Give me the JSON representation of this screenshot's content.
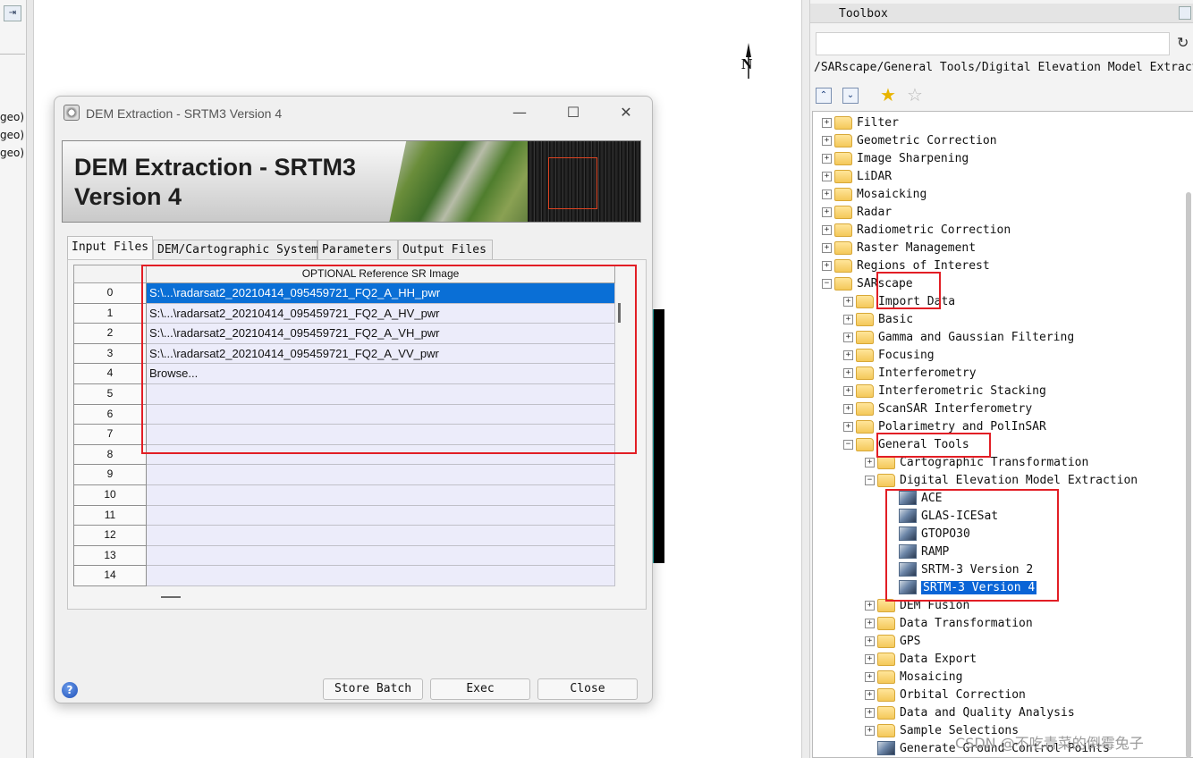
{
  "left_panel": {
    "pin_icon": "pin-icon",
    "lines": [
      "geo)",
      "geo)",
      "geo)"
    ]
  },
  "map": {
    "north_label": "N"
  },
  "dialog": {
    "title": "DEM Extraction - SRTM3 Version 4",
    "banner_line1": "DEM Extraction - SRTM3",
    "banner_line2": "Version 4",
    "controls": {
      "minimize": "—",
      "maximize": "☐",
      "close": "✕"
    },
    "tabs": [
      {
        "label": "Input Files",
        "active": true
      },
      {
        "label": "DEM/Cartographic System",
        "active": false
      },
      {
        "label": "Parameters",
        "active": false
      },
      {
        "label": "Output Files",
        "active": false
      }
    ],
    "grid": {
      "column_header": "OPTIONAL Reference SR Image",
      "rows": [
        {
          "index": "0",
          "value": "S:\\...\\radarsat2_20210414_095459721_FQ2_A_HH_pwr",
          "selected": true
        },
        {
          "index": "1",
          "value": "S:\\...\\radarsat2_20210414_095459721_FQ2_A_HV_pwr",
          "selected": false
        },
        {
          "index": "2",
          "value": "S:\\...\\radarsat2_20210414_095459721_FQ2_A_VH_pwr",
          "selected": false
        },
        {
          "index": "3",
          "value": "S:\\...\\radarsat2_20210414_095459721_FQ2_A_VV_pwr",
          "selected": false
        },
        {
          "index": "4",
          "value": "Browse...",
          "selected": false
        },
        {
          "index": "5",
          "value": "",
          "selected": false
        },
        {
          "index": "6",
          "value": "",
          "selected": false
        },
        {
          "index": "7",
          "value": "",
          "selected": false
        },
        {
          "index": "8",
          "value": "",
          "selected": false
        },
        {
          "index": "9",
          "value": "",
          "selected": false
        },
        {
          "index": "10",
          "value": "",
          "selected": false
        },
        {
          "index": "11",
          "value": "",
          "selected": false
        },
        {
          "index": "12",
          "value": "",
          "selected": false
        },
        {
          "index": "13",
          "value": "",
          "selected": false
        },
        {
          "index": "14",
          "value": "",
          "selected": false
        }
      ]
    },
    "buttons": {
      "store_batch": "Store Batch",
      "exec": "Exec",
      "close": "Close",
      "help": "?"
    }
  },
  "toolbox": {
    "title": "Toolbox",
    "search_value": "",
    "refresh_icon": "↻",
    "path": "/SARscape/General Tools/Digital Elevation Model Extraction",
    "bar": {
      "collapse": "⌃",
      "expand": "⌄",
      "fav_add": "★",
      "fav": "☆"
    },
    "tree": [
      {
        "label": "Filter",
        "level": 0,
        "type": "folder",
        "exp": "+"
      },
      {
        "label": "Geometric Correction",
        "level": 0,
        "type": "folder",
        "exp": "+"
      },
      {
        "label": "Image Sharpening",
        "level": 0,
        "type": "folder",
        "exp": "+"
      },
      {
        "label": "LiDAR",
        "level": 0,
        "type": "folder",
        "exp": "+"
      },
      {
        "label": "Mosaicking",
        "level": 0,
        "type": "folder",
        "exp": "+"
      },
      {
        "label": "Radar",
        "level": 0,
        "type": "folder",
        "exp": "+"
      },
      {
        "label": "Radiometric Correction",
        "level": 0,
        "type": "folder",
        "exp": "+"
      },
      {
        "label": "Raster Management",
        "level": 0,
        "type": "folder",
        "exp": "+"
      },
      {
        "label": "Regions of Interest",
        "level": 0,
        "type": "folder",
        "exp": "+"
      },
      {
        "label": "SARscape",
        "level": 0,
        "type": "folder",
        "exp": "−"
      },
      {
        "label": "Import Data",
        "level": 1,
        "type": "folder",
        "exp": "+"
      },
      {
        "label": "Basic",
        "level": 1,
        "type": "folder",
        "exp": "+"
      },
      {
        "label": "Gamma and Gaussian Filtering",
        "level": 1,
        "type": "folder",
        "exp": "+"
      },
      {
        "label": "Focusing",
        "level": 1,
        "type": "folder",
        "exp": "+"
      },
      {
        "label": "Interferometry",
        "level": 1,
        "type": "folder",
        "exp": "+"
      },
      {
        "label": "Interferometric Stacking",
        "level": 1,
        "type": "folder",
        "exp": "+"
      },
      {
        "label": "ScanSAR Interferometry",
        "level": 1,
        "type": "folder",
        "exp": "+"
      },
      {
        "label": "Polarimetry and PolInSAR",
        "level": 1,
        "type": "folder",
        "exp": "+"
      },
      {
        "label": "General Tools",
        "level": 1,
        "type": "folder",
        "exp": "−"
      },
      {
        "label": "Cartographic Transformation",
        "level": 2,
        "type": "folder",
        "exp": "+"
      },
      {
        "label": "Digital Elevation Model Extraction",
        "level": 2,
        "type": "folder",
        "exp": "−"
      },
      {
        "label": "ACE",
        "level": 3,
        "type": "tool",
        "exp": ""
      },
      {
        "label": "GLAS-ICESat",
        "level": 3,
        "type": "tool",
        "exp": ""
      },
      {
        "label": "GTOPO30",
        "level": 3,
        "type": "tool",
        "exp": ""
      },
      {
        "label": "RAMP",
        "level": 3,
        "type": "tool",
        "exp": ""
      },
      {
        "label": "SRTM-3 Version 2",
        "level": 3,
        "type": "tool",
        "exp": ""
      },
      {
        "label": "SRTM-3 Version 4",
        "level": 3,
        "type": "tool",
        "exp": "",
        "selected": true
      },
      {
        "label": "DEM Fusion",
        "level": 2,
        "type": "folder",
        "exp": "+"
      },
      {
        "label": "Data Transformation",
        "level": 2,
        "type": "folder",
        "exp": "+"
      },
      {
        "label": "GPS",
        "level": 2,
        "type": "folder",
        "exp": "+"
      },
      {
        "label": "Data Export",
        "level": 2,
        "type": "folder",
        "exp": "+"
      },
      {
        "label": "Mosaicing",
        "level": 2,
        "type": "folder",
        "exp": "+"
      },
      {
        "label": "Orbital Correction",
        "level": 2,
        "type": "folder",
        "exp": "+"
      },
      {
        "label": "Data and Quality Analysis",
        "level": 2,
        "type": "folder",
        "exp": "+"
      },
      {
        "label": "Sample Selections",
        "level": 2,
        "type": "folder",
        "exp": "+"
      },
      {
        "label": "Generate Ground Control Points",
        "level": 2,
        "type": "tool",
        "exp": ""
      }
    ]
  },
  "watermark": "CSDN @不吃青菜的倒霉兔子",
  "colors": {
    "selection": "#0a64d6",
    "highlight_box": "#e21e25",
    "grid_cell": "#ececfa"
  }
}
